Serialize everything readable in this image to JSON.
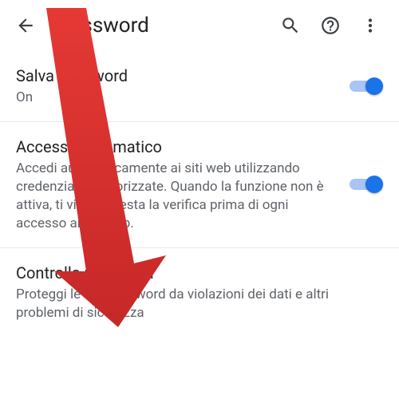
{
  "header": {
    "title": "Password"
  },
  "settings": {
    "savePasswords": {
      "title": "Salva password",
      "status": "On"
    },
    "autoSignin": {
      "title": "Accesso automatico",
      "description": "Accedi automaticamente ai siti web utilizzando credenziali memorizzate. Quando la funzione non è attiva, ti viene chiesta la verifica prima di ogni accesso ai siti web."
    },
    "checkPasswords": {
      "title": "Controlla password",
      "description": "Proteggi le tue password da violazioni dei dati e altri problemi di sicurezza"
    }
  }
}
